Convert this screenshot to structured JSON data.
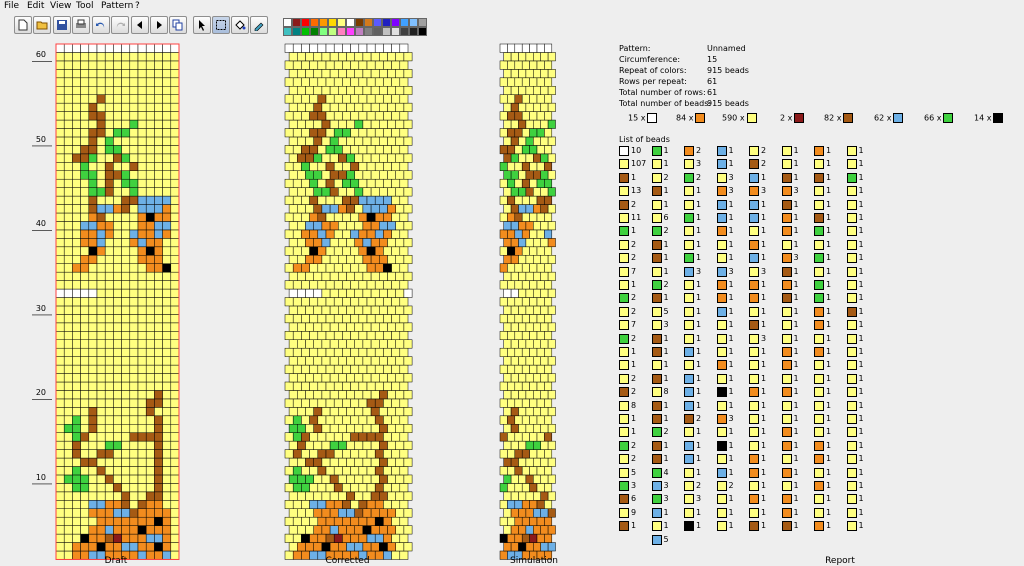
{
  "menu": [
    "File",
    "Edit",
    "View",
    "Tool",
    "Pattern",
    "?"
  ],
  "toolbar": {
    "buttons": [
      "new-file-icon",
      "open-folder-icon",
      "save-icon",
      "print-icon",
      "undo-icon",
      "redo-icon",
      "arrow-left-icon",
      "arrow-right-icon",
      "copy-icon",
      "pointer-icon",
      "select-rect-icon",
      "fill-bucket-icon",
      "eyedropper-icon"
    ]
  },
  "palette": [
    [
      "#ffffff",
      "#8b1a1a",
      "#ff0000",
      "#ff6a00",
      "#ff9900",
      "#ffd800",
      "#ffff80",
      "#ffffff",
      "#7a3b00",
      "#d47a1c",
      "#5a5aff",
      "#2020c0",
      "#7f00ff",
      "#40a0ff",
      "#80c0ff",
      "#a0a0a0"
    ],
    [
      "#40c0c0",
      "#008080",
      "#00c000",
      "#008000",
      "#80ff80",
      "#c0ff80",
      "#ff80c0",
      "#ff40ff",
      "#c080c0",
      "#808080",
      "#606060",
      "#c0c0c0",
      "#e0e0e0",
      "#404040",
      "#202020",
      "#000000"
    ]
  ],
  "colors": {
    "W": "#ffffff",
    "Y": "#ffff80",
    "O": "#f28c1e",
    "B": "#a55a14",
    "L": "#6db0e6",
    "G": "#3fd13f",
    "K": "#000000",
    "R": "#8b1a1a"
  },
  "panes": {
    "draft": "Draft",
    "corrected": "Corrected",
    "simulation": "Simulation",
    "report": "Report"
  },
  "axis_labels": [
    "10",
    "20",
    "30",
    "40",
    "50",
    "60"
  ],
  "info": [
    {
      "k": "Pattern:",
      "v": "Unnamed"
    },
    {
      "k": "Circumference:",
      "v": "15"
    },
    {
      "k": "Repeat of colors:",
      "v": "915 beads"
    },
    {
      "k": "Rows per repeat:",
      "v": "61"
    },
    {
      "k": "Total number of rows:",
      "v": "61"
    },
    {
      "k": "Total number of beads:",
      "v": "915 beads"
    }
  ],
  "bead_counts": [
    {
      "n": "15 x",
      "c": "W"
    },
    {
      "n": "84 x",
      "c": "O"
    },
    {
      "n": "590 x",
      "c": "Y"
    },
    {
      "n": "2 x",
      "c": "R"
    },
    {
      "n": "82 x",
      "c": "B"
    },
    {
      "n": "62 x",
      "c": "L"
    },
    {
      "n": "66 x",
      "c": "G"
    },
    {
      "n": "14 x",
      "c": "K"
    }
  ],
  "list_title": "List of beads",
  "bead_list": [
    [
      "W10",
      "Y107",
      "B1",
      "Y13",
      "B2",
      "Y11",
      "G1",
      "Y2",
      "Y2",
      "Y7",
      "Y1",
      "G2",
      "Y2",
      "Y7",
      "G2",
      "Y1",
      "Y1",
      "Y2",
      "B2",
      "Y8",
      "Y1",
      "Y1",
      "G2",
      "Y2",
      "Y5",
      "G3",
      "B6",
      "Y9",
      "B1"
    ],
    [
      "G1",
      "Y1",
      "Y2",
      "B1",
      "Y1",
      "Y6",
      "G2",
      "B1",
      "B1",
      "Y1",
      "G2",
      "B1",
      "Y5",
      "Y3",
      "B1",
      "B1",
      "Y1",
      "B1",
      "Y8",
      "B1",
      "B1",
      "G2",
      "B1",
      "B1",
      "G4",
      "L3",
      "G3",
      "L1",
      "Y1",
      "L5"
    ],
    [
      "O2",
      "Y3",
      "G2",
      "Y1",
      "Y1",
      "G1",
      "Y1",
      "Y1",
      "G1",
      "L3",
      "Y1",
      "Y1",
      "Y1",
      "Y1",
      "Y1",
      "L1",
      "Y1",
      "L1",
      "L1",
      "L1",
      "B2",
      "Y1",
      "L1",
      "L1",
      "Y1",
      "Y2",
      "Y3",
      "Y1",
      "K1"
    ],
    [
      "L1",
      "L1",
      "Y3",
      "O3",
      "L1",
      "L1",
      "O1",
      "Y1",
      "Y1",
      "L3",
      "O1",
      "O1",
      "L1",
      "Y1",
      "Y1",
      "Y1",
      "O1",
      "Y1",
      "K1",
      "Y1",
      "O3",
      "Y1",
      "K1",
      "Y1",
      "L1",
      "Y2",
      "Y1",
      "Y1",
      "Y1"
    ],
    [
      "Y2",
      "B2",
      "L1",
      "O3",
      "L1",
      "L1",
      "Y1",
      "O1",
      "L1",
      "Y3",
      "O1",
      "O1",
      "Y1",
      "B1",
      "Y3",
      "Y1",
      "Y1",
      "Y1",
      "O1",
      "Y1",
      "Y1",
      "Y1",
      "Y1",
      "O1",
      "O1",
      "Y1",
      "O1",
      "Y1",
      "B1"
    ],
    [
      "Y1",
      "Y1",
      "B1",
      "O3",
      "B1",
      "O1",
      "O1",
      "Y1",
      "O3",
      "B1",
      "O1",
      "B1",
      "Y1",
      "Y1",
      "Y1",
      "O1",
      "O1",
      "Y1",
      "O1",
      "Y1",
      "Y1",
      "O1",
      "O1",
      "Y1",
      "O1",
      "Y1",
      "O1",
      "O1",
      "B1"
    ],
    [
      "O1",
      "Y1",
      "B1",
      "Y1",
      "Y1",
      "B1",
      "G1",
      "Y1",
      "G1",
      "Y1",
      "G1",
      "G1",
      "O1",
      "O1",
      "Y1",
      "O1",
      "Y1",
      "Y1",
      "Y1",
      "Y1",
      "Y1",
      "Y1",
      "O1",
      "O1",
      "Y1",
      "O1",
      "Y1",
      "Y1",
      "O1"
    ],
    [
      "Y1",
      "Y1",
      "G1",
      "Y1",
      "Y1",
      "Y1",
      "Y1",
      "Y1",
      "Y1",
      "Y1",
      "Y1",
      "Y1",
      "B1",
      "Y1",
      "Y1",
      "Y1",
      "Y1",
      "Y1",
      "Y1",
      "Y1",
      "Y1",
      "Y1",
      "Y1",
      "Y1",
      "Y1",
      "Y1",
      "Y1",
      "Y1",
      "Y1"
    ]
  ]
}
